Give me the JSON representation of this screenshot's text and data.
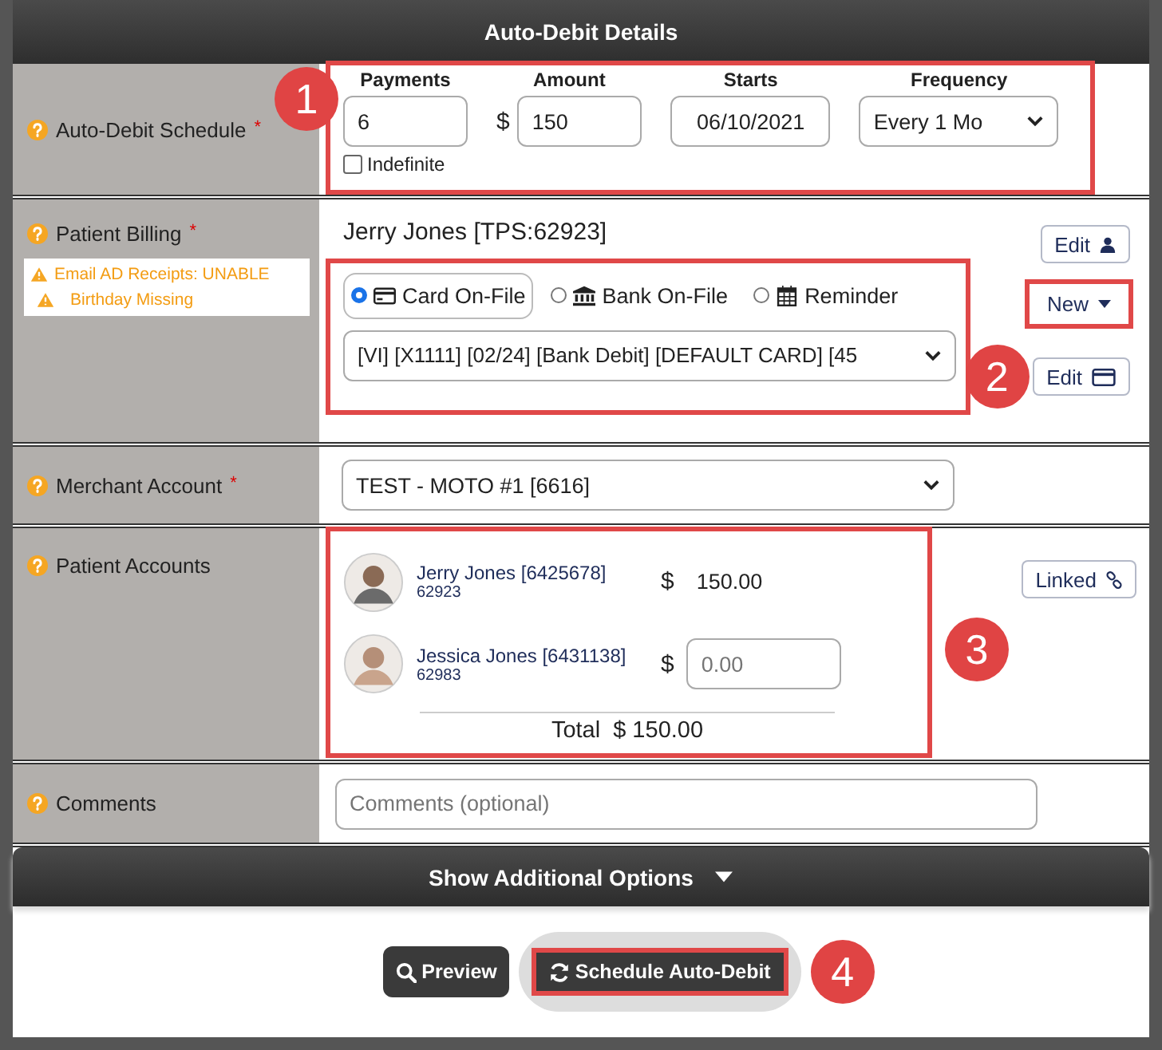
{
  "header": {
    "title": "Auto-Debit Details"
  },
  "schedule": {
    "label": "Auto-Debit Schedule",
    "mark": "*",
    "callout": "1",
    "payments": {
      "label": "Payments",
      "value": "6"
    },
    "amount": {
      "label": "Amount",
      "currency": "$",
      "value": "150"
    },
    "starts": {
      "label": "Starts",
      "value": "06/10/2021"
    },
    "frequency": {
      "label": "Frequency",
      "value": "Every 1 Mo"
    },
    "indefinite": {
      "label": "Indefinite",
      "checked": false
    }
  },
  "billing": {
    "label": "Patient Billing",
    "mark": "*",
    "warnings": [
      "Email AD Receipts: UNABLE",
      "Birthday Missing"
    ],
    "patient": "Jerry Jones [TPS:62923]",
    "edit_button": "Edit",
    "callout": "2",
    "methods": [
      {
        "kind": "card",
        "label": "Card On-File",
        "selected": true
      },
      {
        "kind": "bank",
        "label": "Bank On-File",
        "selected": false
      },
      {
        "kind": "reminder",
        "label": "Reminder",
        "selected": false
      }
    ],
    "card_select": "[VI] [X1111] [02/24] [Bank Debit] [DEFAULT CARD] [45",
    "new_button": "New",
    "edit_card_button": "Edit"
  },
  "merchant": {
    "label": "Merchant Account",
    "mark": "*",
    "value": "TEST - MOTO #1 [6616]"
  },
  "accounts": {
    "label": "Patient Accounts",
    "linked_button": "Linked",
    "callout": "3",
    "rows": [
      {
        "kind": "amount",
        "name": "Jerry Jones [6425678]",
        "id": "62923",
        "currency": "$",
        "amount": "150.00"
      },
      {
        "kind": "input",
        "name": "Jessica Jones [6431138]",
        "id": "62983",
        "currency": "$",
        "placeholder": "0.00"
      }
    ],
    "total_label": "Total",
    "total": "$ 150.00"
  },
  "comments": {
    "label": "Comments",
    "placeholder": "Comments (optional)"
  },
  "more_options": "Show Additional Options",
  "buttons": {
    "preview": "Preview",
    "schedule": "Schedule Auto-Debit",
    "callout": "4"
  }
}
